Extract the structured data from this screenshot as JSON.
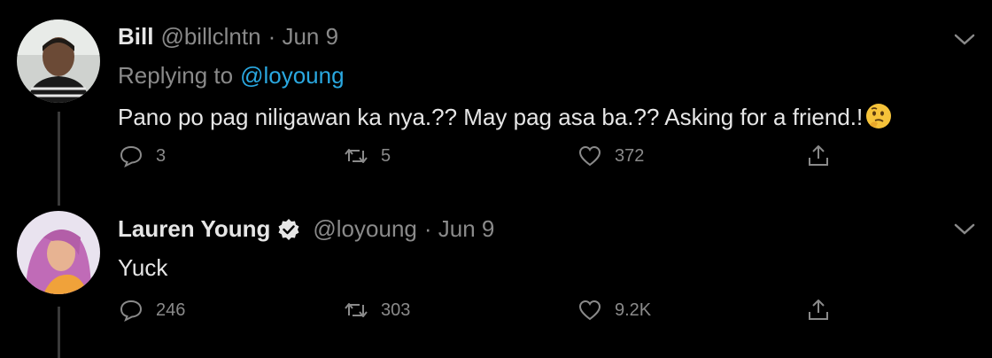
{
  "tweets": [
    {
      "name": "Bill",
      "handle": "@billclntn",
      "date": "· Jun 9",
      "replying_prefix": "Replying to",
      "replying_to": "@loyoung",
      "text": "Pano po pag niligawan ka nya.?? May pag asa ba.?? Asking for a friend.!",
      "emoji": "thinking-face",
      "replies": "3",
      "retweets": "5",
      "likes": "372",
      "verified": false
    },
    {
      "name": "Lauren Young",
      "handle": "@loyoung",
      "date": "· Jun 9",
      "text": "Yuck",
      "replies": "246",
      "retweets": "303",
      "likes": "9.2K",
      "verified": true
    }
  ],
  "colors": {
    "background": "#000000",
    "accent": "#2aa8e0",
    "muted": "#8a8a8a",
    "text": "#e6e6e6"
  },
  "icons": [
    "reply-icon",
    "retweet-icon",
    "like-icon",
    "share-icon",
    "chevron-down-icon",
    "verified-badge-icon"
  ]
}
